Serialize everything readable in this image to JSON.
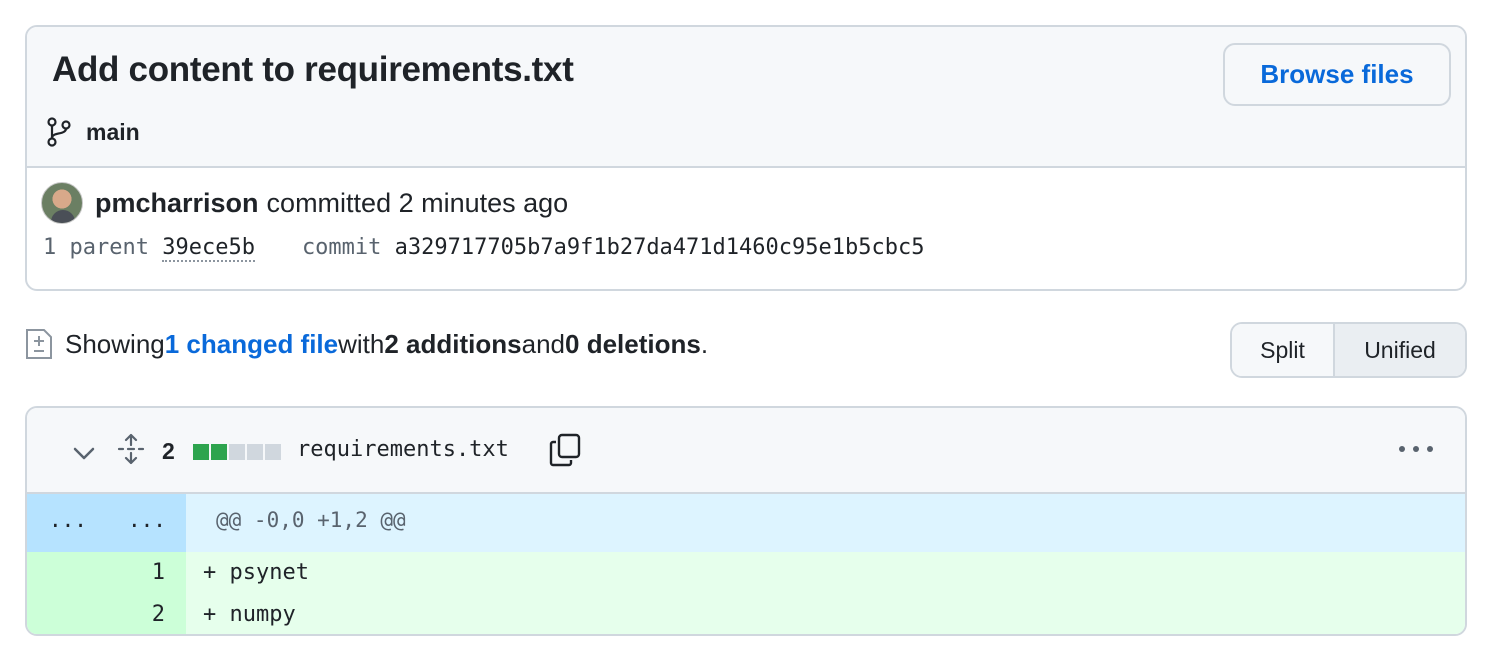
{
  "commit": {
    "title": "Add content to requirements.txt",
    "browse_label": "Browse files",
    "branch": "main",
    "author": "pmcharrison",
    "action": "committed 2 minutes ago",
    "parent_label": "1 parent ",
    "parent_sha": "39ece5b",
    "commit_label": "commit ",
    "commit_sha": "a329717705b7a9f1b27da471d1460c95e1b5cbc5"
  },
  "summary": {
    "prefix": "Showing ",
    "changed_link": "1 changed file",
    "with": " with ",
    "additions": "2 additions",
    "and": " and ",
    "deletions": "0 deletions",
    "suffix": "."
  },
  "view_toggle": {
    "split": "Split",
    "unified": "Unified",
    "selected": "Unified"
  },
  "file": {
    "change_count": "2",
    "diffstat": {
      "additions": 2,
      "deletions": 0,
      "blocks": [
        "add",
        "add",
        "neutral",
        "neutral",
        "neutral"
      ]
    },
    "name": "requirements.txt",
    "hunk": {
      "left_expand": "...",
      "right_expand": "...",
      "header": "@@ -0,0 +1,2 @@"
    },
    "lines": [
      {
        "number": "1",
        "code": "+ psynet"
      },
      {
        "number": "2",
        "code": "+ numpy"
      }
    ]
  },
  "colors": {
    "accent": "#0969da",
    "addition": "#2da44e",
    "addition_bg": "#e6ffec",
    "addition_gutter": "#ccffd8",
    "hunk_bg": "#ddf4ff",
    "hunk_gutter": "#b6e3ff"
  }
}
